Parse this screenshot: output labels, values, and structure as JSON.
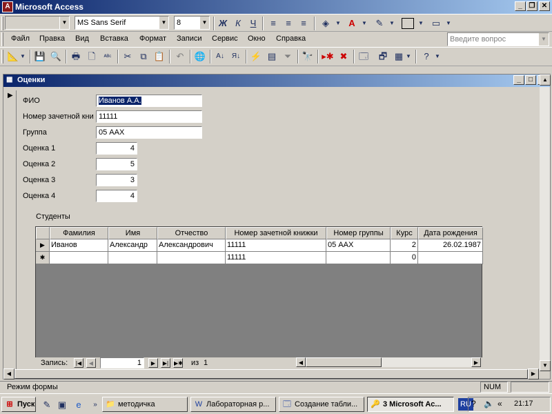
{
  "app": {
    "title": "Microsoft Access"
  },
  "formatting_toolbar": {
    "object_combo": "",
    "font_name": "MS Sans Serif",
    "font_size": "8",
    "bold": "Ж",
    "italic": "К",
    "underline": "Ч"
  },
  "menu": {
    "items": [
      "Файл",
      "Правка",
      "Вид",
      "Вставка",
      "Формат",
      "Записи",
      "Сервис",
      "Окно",
      "Справка"
    ],
    "help_placeholder": "Введите вопрос"
  },
  "child_window": {
    "title": "Оценки"
  },
  "form": {
    "fields": [
      {
        "label": "ФИО",
        "value": "Иванов А.А."
      },
      {
        "label": "Номер зачетной кни",
        "value": "11111"
      },
      {
        "label": "Группа",
        "value": "05 ААХ"
      },
      {
        "label": "Оценка 1",
        "value": "4"
      },
      {
        "label": "Оценка 2",
        "value": "5"
      },
      {
        "label": "Оценка 3",
        "value": "3"
      },
      {
        "label": "Оценка 4",
        "value": "4"
      }
    ],
    "subform_label": "Студенты"
  },
  "grid": {
    "columns": [
      "Фамилия",
      "Имя",
      "Отчество",
      "Номер зачетной книжки",
      "Номер группы",
      "Курс",
      "Дата рождения"
    ],
    "rows": [
      {
        "marker": "▶",
        "cells": [
          "Иванов",
          "Александр",
          "Александрович",
          "11111",
          "05 ААХ",
          "2",
          "26.02.1987"
        ]
      },
      {
        "marker": "✱",
        "cells": [
          "",
          "",
          "",
          "11111",
          "",
          "0",
          ""
        ]
      }
    ]
  },
  "record_nav": {
    "label": "Запись:",
    "current": "1",
    "of_label": "из",
    "total": "1"
  },
  "status": {
    "mode": "Режим формы",
    "num": "NUM"
  },
  "taskbar": {
    "start": "Пуск",
    "buttons": [
      "методичка",
      "Лабораторная р...",
      "Создание табли...",
      "3 Microsoft Ac..."
    ],
    "lang": "RU",
    "clock": "21:17"
  }
}
